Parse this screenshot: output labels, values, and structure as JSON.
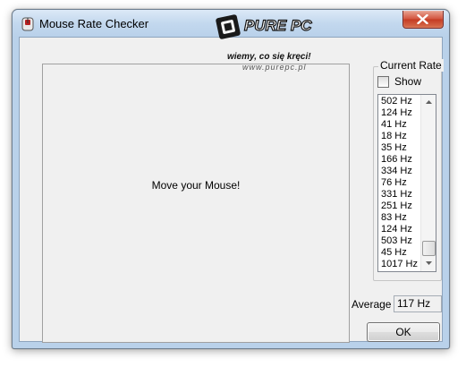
{
  "window": {
    "title": "Mouse Rate Checker",
    "app_icon": "mouse-app-icon",
    "close_icon": "close-icon"
  },
  "watermark": {
    "logo_text": "PURE PC",
    "tagline": "wiemy, co się kręci!",
    "url": "www.purepc.pl"
  },
  "drawing_area": {
    "label": "Move your Mouse!"
  },
  "current_rate": {
    "group_title": "Current Rate",
    "show_label": "Show",
    "show_checked": false,
    "rates": [
      "502 Hz",
      "124 Hz",
      "41 Hz",
      "18 Hz",
      "35 Hz",
      "166 Hz",
      "334 Hz",
      "76 Hz",
      "331 Hz",
      "251 Hz",
      "83 Hz",
      "124 Hz",
      "503 Hz",
      "45 Hz",
      "1017 Hz"
    ]
  },
  "average": {
    "label": "Average",
    "value": "117 Hz"
  },
  "buttons": {
    "ok_label": "OK"
  },
  "colors": {
    "window_frame": "#b9d1ea",
    "client_background": "#f0f0f0",
    "close_button": "#c43a22"
  }
}
